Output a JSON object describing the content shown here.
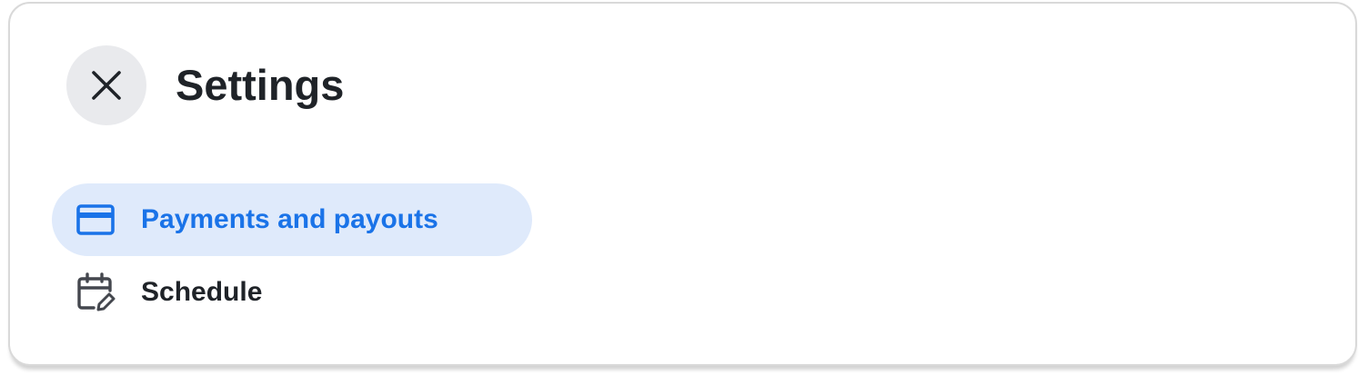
{
  "header": {
    "close_icon": "close-icon",
    "title": "Settings"
  },
  "menu": {
    "items": [
      {
        "label": "Payments and payouts",
        "icon": "credit-card-icon",
        "active": true
      },
      {
        "label": "Schedule",
        "icon": "calendar-edit-icon",
        "active": false
      }
    ]
  },
  "colors": {
    "accent": "#1a73e8",
    "active_bg": "#dfeafb",
    "text": "#1f2328",
    "close_bg": "#e9eaed"
  }
}
